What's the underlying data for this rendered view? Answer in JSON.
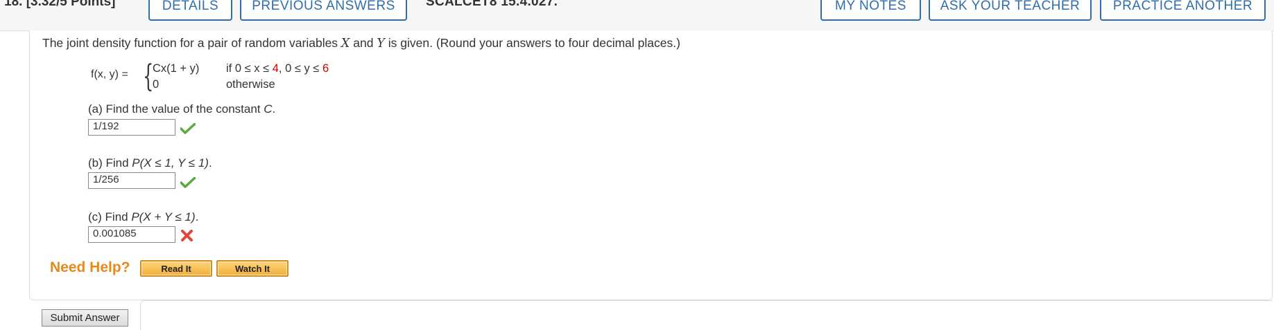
{
  "question": {
    "number_points": "18. [3.32/5 Points]",
    "assignment_id": "SCALCET8 15.4.027."
  },
  "tabs": {
    "details": "DETAILS",
    "previous_answers": "PREVIOUS ANSWERS",
    "my_notes": "MY NOTES",
    "ask_teacher": "ASK YOUR TEACHER",
    "practice_another": "PRACTICE ANOTHER"
  },
  "problem": {
    "prompt_pre": "The joint density function for a pair of random variables ",
    "var_x": "X",
    "prompt_and": " and ",
    "var_y": "Y",
    "prompt_post": " is given. (Round your answers to four decimal places.)",
    "function_label": "f(x, y) =",
    "case1_expr": "Cx(1 + y)",
    "case1_cond_pre": "if 0 ≤ x ≤ ",
    "case1_x_max": "4",
    "case1_cond_mid": ", 0 ≤ y ≤ ",
    "case1_y_max": "6",
    "case2_expr": "0",
    "case2_cond": "otherwise"
  },
  "parts": [
    {
      "label_pre": "(a) Find the value of the constant ",
      "label_var": "C",
      "label_post": ".",
      "answer": "1/192",
      "status": "correct"
    },
    {
      "label_pre": "(b) Find ",
      "label_var": "P(X ≤ 1, Y ≤ 1)",
      "label_post": ".",
      "answer": "1/256",
      "status": "correct"
    },
    {
      "label_pre": "(c) Find ",
      "label_var": "P(X + Y ≤ 1)",
      "label_post": ".",
      "answer": "0.001085",
      "status": "incorrect"
    }
  ],
  "help": {
    "title": "Need Help?",
    "read_it": "Read It",
    "watch_it": "Watch It"
  },
  "submit_label": "Submit Answer",
  "colors": {
    "tab_blue": "#2f6ea9",
    "help_orange": "#e88a1b",
    "correct_green": "#5aab3c",
    "incorrect_red": "#e0443a",
    "highlight_red": "#cc0000"
  }
}
